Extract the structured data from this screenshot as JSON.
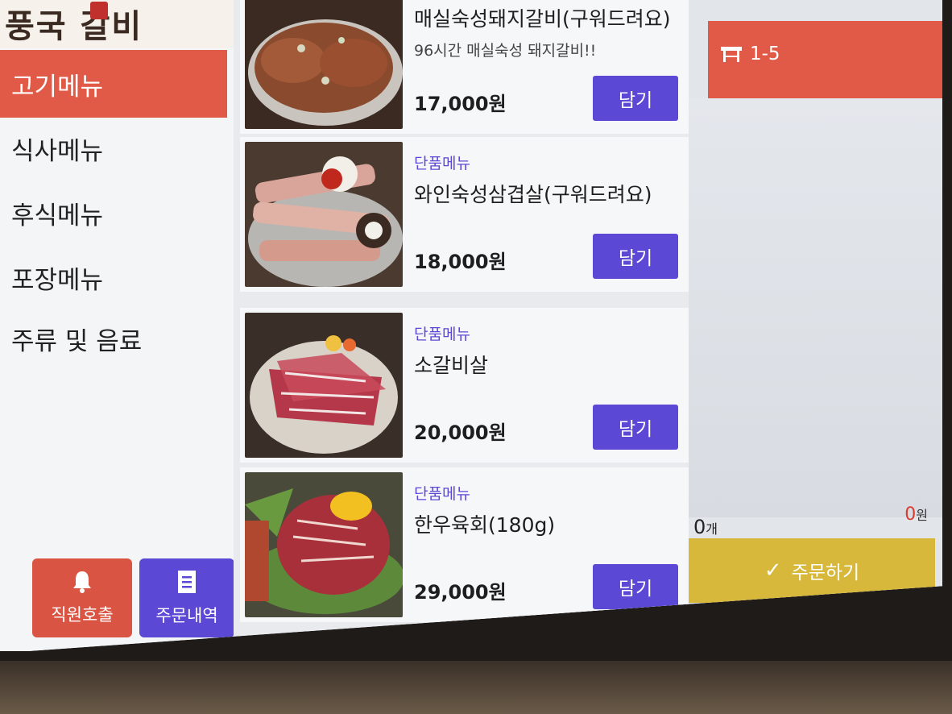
{
  "brand": {
    "logo_text": "풍국 갈비"
  },
  "sidebar": {
    "items": [
      {
        "label": "고기메뉴",
        "active": true
      },
      {
        "label": "식사메뉴",
        "active": false
      },
      {
        "label": "후식메뉴",
        "active": false
      },
      {
        "label": "포장메뉴",
        "active": false
      },
      {
        "label": "주류 및 음료",
        "active": false
      }
    ],
    "staff_call_label": "직원호출",
    "order_history_label": "주문내역"
  },
  "menu": {
    "items": [
      {
        "category": "",
        "name": "매실숙성돼지갈비(구워드려요)",
        "description": "96시간 매실숙성 돼지갈비!!",
        "price": "17,000원",
        "add_label": "담기"
      },
      {
        "category": "단품메뉴",
        "name": "와인숙성삼겹살(구워드려요)",
        "description": "",
        "price": "18,000원",
        "add_label": "담기"
      },
      {
        "category": "단품메뉴",
        "name": "소갈비살",
        "description": "",
        "price": "20,000원",
        "add_label": "담기"
      },
      {
        "category": "단품메뉴",
        "name": "한우육회(180g)",
        "description": "",
        "price": "29,000원",
        "add_label": "담기"
      }
    ]
  },
  "cart": {
    "table_no": "1-5",
    "count": "0",
    "count_unit": "개",
    "total": "0",
    "total_unit": "원",
    "order_label": "주문하기"
  },
  "colors": {
    "accent_red": "#e05a47",
    "accent_purple": "#5b49d6",
    "order_yellow": "#d7b83a"
  }
}
